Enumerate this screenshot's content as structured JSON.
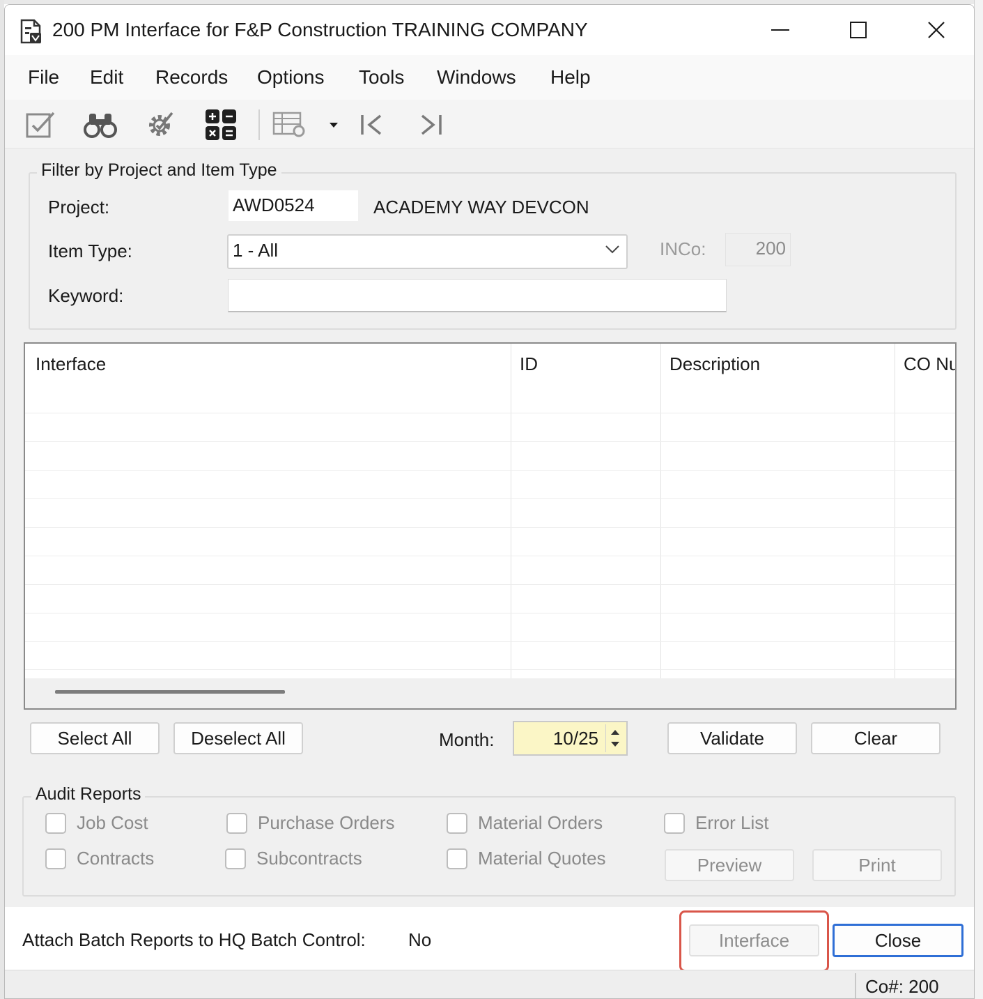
{
  "window": {
    "title": "200 PM Interface for F&P Construction TRAINING COMPANY",
    "icons": {
      "app": "form-document-icon",
      "minimize": "minimize-icon",
      "maximize": "maximize-icon",
      "close": "close-icon"
    }
  },
  "menu": {
    "items": [
      "File",
      "Edit",
      "Records",
      "Options",
      "Tools",
      "Windows",
      "Help"
    ]
  },
  "toolbar": {
    "icons": [
      "edit-check-icon",
      "binoculars-icon",
      "settings-gear-icon",
      "calculator-icon",
      "grid-settings-icon",
      "dropdown-arrow-icon",
      "first-record-icon",
      "last-record-icon"
    ]
  },
  "filter": {
    "group_title": "Filter by Project and Item Type",
    "project_label": "Project:",
    "project_value": "AWD0524",
    "project_name": "ACADEMY WAY DEVCON",
    "item_type_label": "Item Type:",
    "item_type_value": "1 - All",
    "inco_label": "INCo:",
    "inco_value": "200",
    "keyword_label": "Keyword:",
    "keyword_value": ""
  },
  "grid": {
    "columns": [
      "Interface",
      "ID",
      "Description",
      "CO Nu"
    ],
    "rows": []
  },
  "actions": {
    "select_all": "Select All",
    "deselect_all": "Deselect All",
    "month_label": "Month:",
    "month_value": "10/25",
    "validate": "Validate",
    "clear": "Clear"
  },
  "audit": {
    "group_title": "Audit Reports",
    "checkboxes": [
      {
        "label": "Job Cost",
        "checked": false
      },
      {
        "label": "Purchase Orders",
        "checked": false
      },
      {
        "label": "Material Orders",
        "checked": false
      },
      {
        "label": "Error List",
        "checked": false
      },
      {
        "label": "Contracts",
        "checked": false
      },
      {
        "label": "Subcontracts",
        "checked": false
      },
      {
        "label": "Material Quotes",
        "checked": false
      }
    ],
    "preview": "Preview",
    "print": "Print"
  },
  "footer": {
    "attach_label": "Attach Batch Reports to HQ Batch Control:",
    "attach_value": "No",
    "interface_button": "Interface",
    "close_button": "Close"
  },
  "status": {
    "company": "Co#: 200"
  },
  "colors": {
    "highlight": "#d9564a",
    "primary_border": "#2f6fd6",
    "month_bg": "#fbf6c6"
  }
}
